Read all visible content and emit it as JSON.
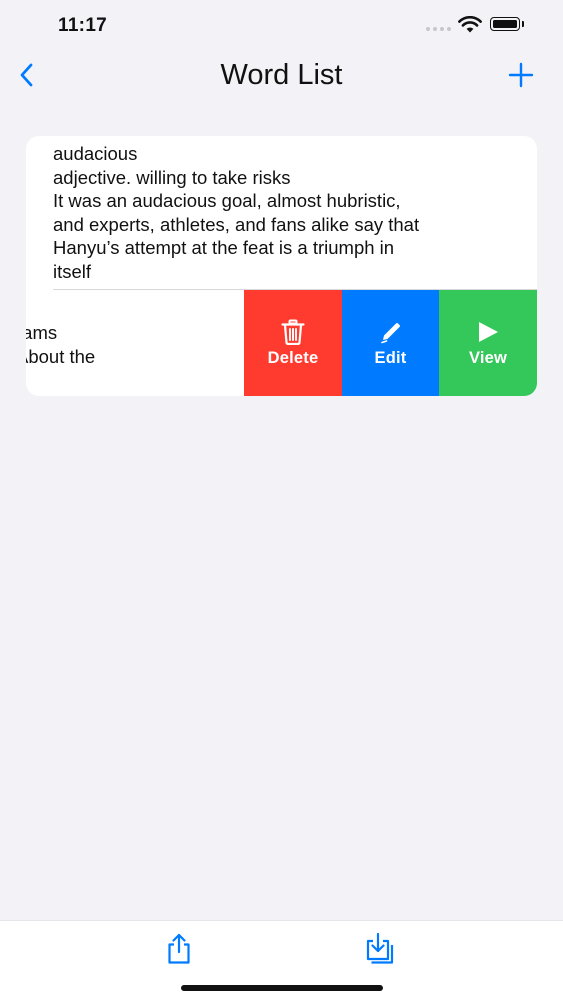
{
  "status_bar": {
    "time": "11:17"
  },
  "nav": {
    "title": "Word List",
    "back_icon": "chevron-left-icon",
    "add_icon": "plus-icon"
  },
  "list": {
    "items": [
      {
        "lines": [
          "audacious",
          "adjective. willing to take risks",
          "It was an audacious goal, almost hubristic,",
          "and experts, athletes, and fans alike say that",
          "Hanyu’s attempt at the feat is a triumph in",
          "itself"
        ]
      },
      {
        "lines": [
          "rams",
          "About the"
        ]
      }
    ]
  },
  "swipe_actions": {
    "delete_label": "Delete",
    "edit_label": "Edit",
    "view_label": "View"
  },
  "toolbar": {
    "share_icon": "share-icon",
    "import_icon": "import-icon"
  },
  "colors": {
    "accent": "#007aff",
    "delete": "#ff3b30",
    "edit": "#007aff",
    "view": "#34c759",
    "background": "#f2f2f7"
  }
}
